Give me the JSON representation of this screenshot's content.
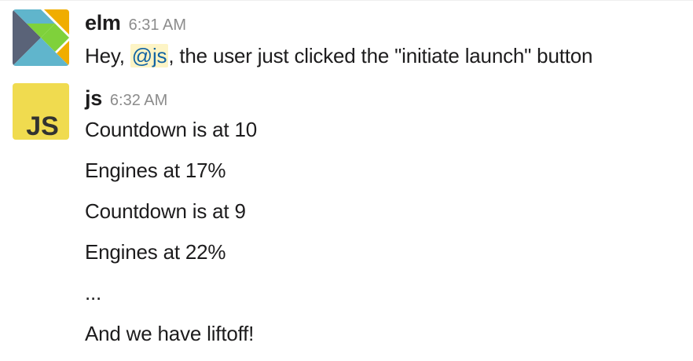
{
  "messages": [
    {
      "author": "elm",
      "time": "6:31 AM",
      "avatar": {
        "icon": "elm-logo-icon",
        "colors": {
          "slate": "#5A6378",
          "blue": "#60B5CC",
          "green": "#7FD13B",
          "orange": "#F0AD00"
        }
      },
      "body": {
        "prefix": "Hey, ",
        "mention": "@js",
        "suffix": ", the user just clicked the \"initiate launch\" button"
      }
    },
    {
      "author": "js",
      "time": "6:32 AM",
      "avatar": {
        "icon": "javascript-logo-icon",
        "text": "JS",
        "colors": {
          "bg": "#F0DB4F",
          "text": "#323330"
        }
      },
      "lines": [
        "Countdown is at 10",
        "Engines at 17%",
        "Countdown is at 9",
        "Engines at 22%",
        "...",
        "And we have liftoff!"
      ]
    }
  ]
}
